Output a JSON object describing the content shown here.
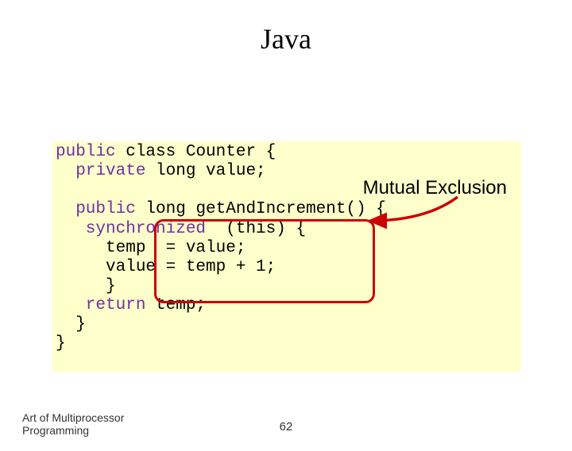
{
  "title": "Java",
  "annotation": "Mutual Exclusion",
  "code": {
    "l1a": "public",
    "l1b": " class Counter {",
    "l2a": "  private",
    "l2b": " long value;",
    "l3": "",
    "l4a": "  public",
    "l4b": " long getAndIncrement() {",
    "l5a": "   synchronized",
    "l5b": "  (this) {",
    "l6": "     temp  = value;",
    "l7": "     value = temp + 1;",
    "l8": "     }",
    "l9a": "   return",
    "l9b": " temp;",
    "l10": "  }",
    "l11": "}"
  },
  "footer": {
    "line1": "Art of Multiprocessor",
    "line2": "Programming"
  },
  "page_number": "62"
}
